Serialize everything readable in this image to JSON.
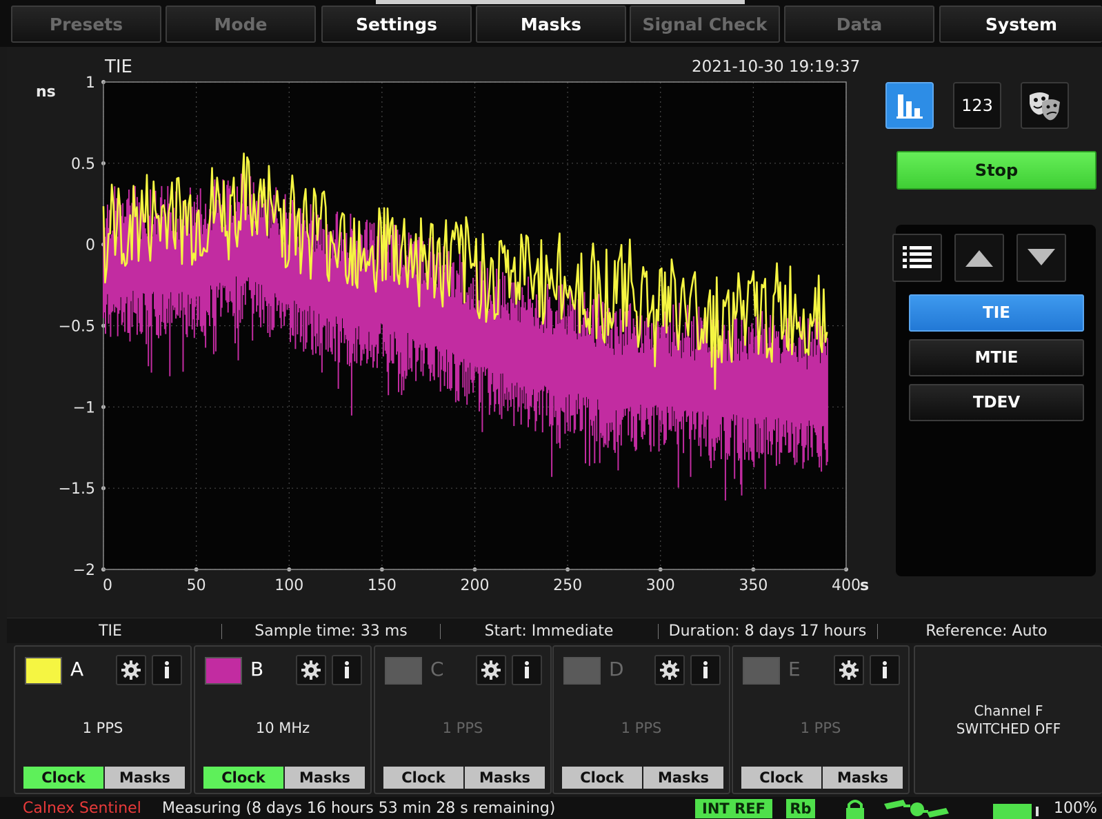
{
  "menu": {
    "tabs": [
      {
        "label": "Presets",
        "enabled": false
      },
      {
        "label": "Mode",
        "enabled": false
      },
      {
        "label": "Settings",
        "enabled": true
      },
      {
        "label": "Masks",
        "enabled": true
      },
      {
        "label": "Signal Check",
        "enabled": false
      },
      {
        "label": "Data",
        "enabled": false
      },
      {
        "label": "System",
        "enabled": true
      }
    ]
  },
  "plot": {
    "title": "TIE",
    "timestamp": "2021-10-30 19:19:37",
    "y_unit": "ns",
    "x_unit": "s"
  },
  "chart_data": {
    "type": "line",
    "title": "TIE",
    "xlabel": "s",
    "ylabel": "ns",
    "xlim": [
      0,
      400
    ],
    "ylim": [
      -2,
      1
    ],
    "x_ticks": [
      "0",
      "50",
      "100",
      "150",
      "200",
      "250",
      "300",
      "350",
      "400"
    ],
    "y_ticks": [
      "1",
      "0.5",
      "0",
      "−0.5",
      "−1",
      "−1.5",
      "−2"
    ],
    "grid": true,
    "series": [
      {
        "name": "A",
        "color": "#f5f542",
        "x": [
          0,
          25,
          50,
          75,
          100,
          125,
          150,
          175,
          200,
          225,
          250,
          275,
          300,
          325,
          350,
          375,
          390
        ],
        "y": [
          0.05,
          0.15,
          0.15,
          0.25,
          0.15,
          0.05,
          0.0,
          -0.1,
          -0.15,
          -0.2,
          -0.25,
          -0.3,
          -0.35,
          -0.45,
          -0.45,
          -0.4,
          -0.35
        ],
        "spread": 0.32
      },
      {
        "name": "B",
        "color": "#c22ca1",
        "x": [
          0,
          25,
          50,
          75,
          100,
          125,
          150,
          175,
          200,
          225,
          250,
          275,
          300,
          325,
          350,
          375,
          390
        ],
        "y": [
          -0.15,
          -0.15,
          -0.15,
          -0.05,
          -0.2,
          -0.3,
          -0.35,
          -0.45,
          -0.6,
          -0.7,
          -0.75,
          -0.85,
          -0.85,
          -0.9,
          -0.9,
          -0.95,
          -0.95
        ],
        "spread": 0.38
      }
    ]
  },
  "views": {
    "graph_icon": "bar-chart-icon",
    "numeric_label": "123",
    "theme_icon": "theatre-masks-icon"
  },
  "stop_label": "Stop",
  "measurements": {
    "list_icon": "list-icon",
    "items": [
      "TIE",
      "MTIE",
      "TDEV"
    ],
    "selected": "TIE"
  },
  "info": {
    "measurement": "TIE",
    "sample_time": "Sample time: 33 ms",
    "start": "Start: Immediate",
    "duration": "Duration: 8 days 17 hours",
    "reference": "Reference: Auto"
  },
  "channels": [
    {
      "letter": "A",
      "color": "#f5f542",
      "signal": "1 PPS",
      "active": true,
      "clock_label": "Clock",
      "masks_label": "Masks"
    },
    {
      "letter": "B",
      "color": "#c22ca1",
      "signal": "10 MHz",
      "active": true,
      "clock_label": "Clock",
      "masks_label": "Masks"
    },
    {
      "letter": "C",
      "color": "#5a5a5a",
      "signal": "1 PPS",
      "active": false,
      "clock_label": "Clock",
      "masks_label": "Masks"
    },
    {
      "letter": "D",
      "color": "#5a5a5a",
      "signal": "1 PPS",
      "active": false,
      "clock_label": "Clock",
      "masks_label": "Masks"
    },
    {
      "letter": "E",
      "color": "#5a5a5a",
      "signal": "1 PPS",
      "active": false,
      "clock_label": "Clock",
      "masks_label": "Masks"
    }
  ],
  "channel_f": {
    "line1": "Channel F",
    "line2": "SWITCHED OFF"
  },
  "status": {
    "brand": "Calnex Sentinel",
    "message": "Measuring (8 days 16 hours 53 min 28 s remaining)",
    "int_ref": "INT REF",
    "rb": "Rb",
    "battery_pct": "100%",
    "battery_level": 1.0
  }
}
